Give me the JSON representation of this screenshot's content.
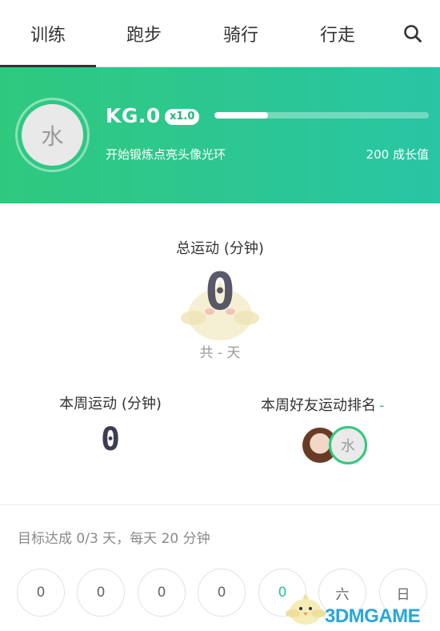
{
  "tabs": [
    {
      "label": "训练",
      "active": true
    },
    {
      "label": "跑步",
      "active": false
    },
    {
      "label": "骑行",
      "active": false
    },
    {
      "label": "行走",
      "active": false
    }
  ],
  "search_icon": "search-icon",
  "level": {
    "avatar_char": "水",
    "name": "KG.0",
    "multiplier": "x1.0",
    "progress": 0.25,
    "hint": "开始锻炼点亮头像光环",
    "growth": "200 成长值",
    "colors": {
      "gradient_start": "#2fc97e",
      "gradient_end": "#29c5a4"
    }
  },
  "total": {
    "label": "总运动 (分钟)",
    "value": "0",
    "days": "共 - 天"
  },
  "week": {
    "label": "本周运动 (分钟)",
    "value": "0",
    "rank_label": "本周好友运动排名",
    "rank_value": "-",
    "friend_avatar_char": "水"
  },
  "goal": {
    "text": "目标达成 0/3 天，每天 20 分钟",
    "days": [
      "0",
      "0",
      "0",
      "0",
      "0",
      "六",
      "日"
    ],
    "today_index": 4
  },
  "watermark": "3DMGAME"
}
